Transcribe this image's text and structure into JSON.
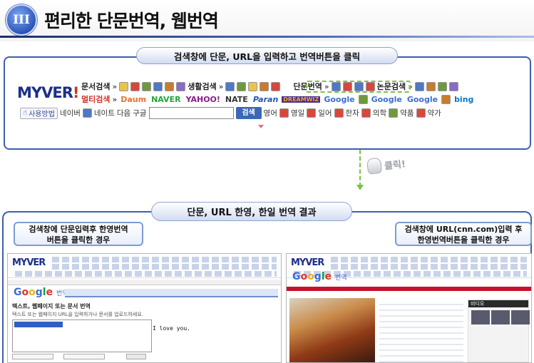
{
  "header": {
    "numeral": "III",
    "title": "편리한 단문번역, 웹번역"
  },
  "step1": {
    "label": "검색창에 단문, URL을 입력하고 번역버튼을 클릭"
  },
  "toolbar": {
    "logo": "MYVER",
    "logo_mark": "!",
    "row1": {
      "doc_search": "문서검색",
      "life_search": "생활검색",
      "short_translate": "단문번역",
      "paper_search": "논문검색",
      "sep": "»"
    },
    "row2": {
      "multi_search": "멀티검색",
      "daum": "Daum",
      "naver": "NAVER",
      "yahoo": "YAHOO!",
      "nate": "NATE",
      "paran": "Paran",
      "dreamwiz": "DREAMWIZ",
      "google": "Google",
      "bing": "bing"
    },
    "row3": {
      "usage": "사용방법",
      "links": [
        "네이버",
        "네이트",
        "다음",
        "구글"
      ],
      "search_button": "검색",
      "options": [
        "영어",
        "영일",
        "일어",
        "한자",
        "의학",
        "약품",
        "약가"
      ]
    }
  },
  "click_hint": "클릭!",
  "step2": {
    "label": "단문, URL 한영, 한일 번역 결과"
  },
  "left_case": {
    "line1": "검색창에 단문입력후 한영번역",
    "line2": "버튼을 클릭한 경우",
    "screenshot": {
      "logo": "MYVER",
      "google_suffix": "번역",
      "section_title": "텍스트, 웹페이지 또는 문서 번역",
      "hint": "텍스트 또는 웹페이지 URL을 입력하거나 문서를 업로드하세요.",
      "translation": "I love you."
    }
  },
  "right_case": {
    "line1": "검색창에 URL(cnn.com)입력 후",
    "line2": "한영번역버튼을 클릭한 경우",
    "screenshot": {
      "logo": "MYVER",
      "google_suffix": "번역",
      "video_label": "비디오"
    }
  }
}
